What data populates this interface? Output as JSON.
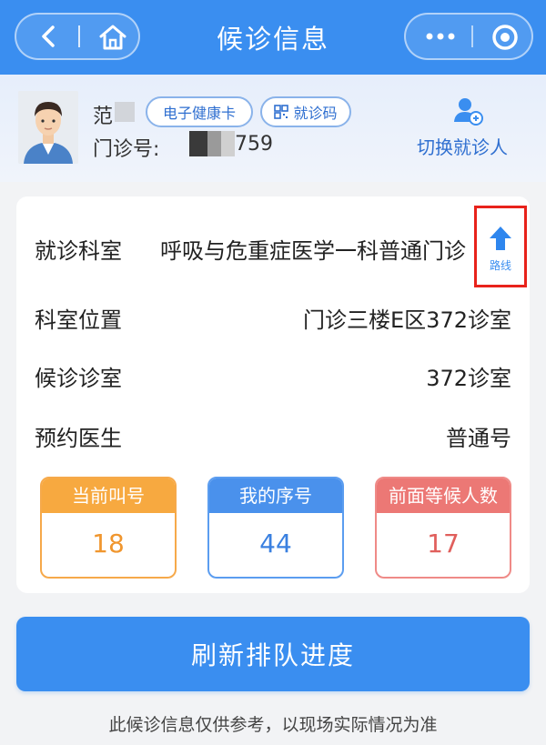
{
  "header": {
    "title": "候诊信息",
    "back_icon": "chevron-left-icon",
    "home_icon": "home-icon",
    "more_icon": "more-dots-icon",
    "close_icon": "target-circle-icon"
  },
  "patient": {
    "name_visible": "范",
    "health_card_label": "电子健康卡",
    "visit_code_label": "就诊码",
    "outpatient_no_label": "门诊号:",
    "outpatient_no_suffix": "759",
    "switch_label": "切换就诊人"
  },
  "details": {
    "dept_label": "就诊科室",
    "dept_value": "呼吸与危重症医学一科普通门诊",
    "route_label": "路线",
    "location_label": "科室位置",
    "location_value": "门诊三楼E区372诊室",
    "room_label": "候诊诊室",
    "room_value": "372诊室",
    "doctor_label": "预约医生",
    "doctor_value": "普通号"
  },
  "queue": {
    "current_label": "当前叫号",
    "current_value": "18",
    "mine_label": "我的序号",
    "mine_value": "44",
    "waiting_label": "前面等候人数",
    "waiting_value": "17"
  },
  "actions": {
    "refresh_label": "刷新排队进度"
  },
  "footer": {
    "note": "此候诊信息仅供参考，以现场实际情况为准"
  },
  "colors": {
    "primary": "#3a8ef0",
    "orange": "#f7a940",
    "blue": "#4a91ec",
    "red": "#ec7875",
    "highlight": "#e8221b"
  }
}
